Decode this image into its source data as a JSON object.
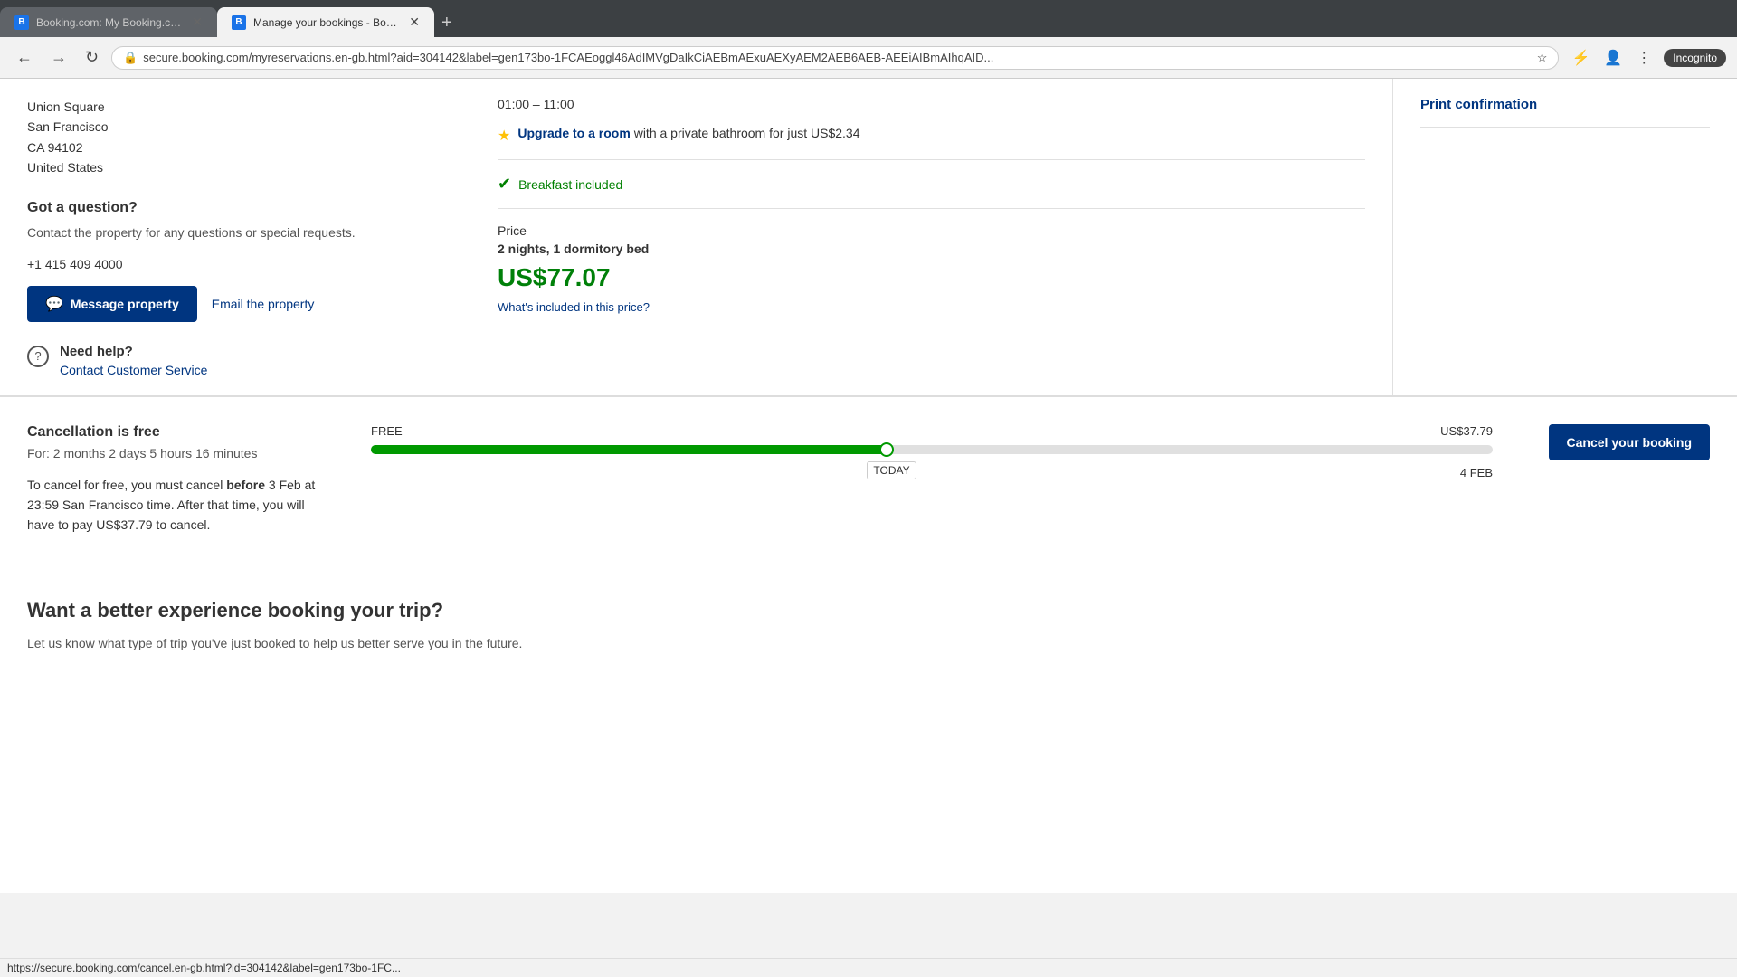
{
  "browser": {
    "tabs": [
      {
        "id": "tab1",
        "favicon": "B",
        "title": "Booking.com: My Booking.com",
        "active": false
      },
      {
        "id": "tab2",
        "favicon": "B",
        "title": "Manage your bookings - Booki...",
        "active": true
      }
    ],
    "new_tab_label": "+",
    "address": "secure.booking.com/myreservations.en-gb.html?aid=304142&label=gen173bo-1FCAEoggl46AdIMVgDaIkCiAEBmAExuAEXyAEM2AEB6AEB-AEEiAIBmAIhqAID...",
    "incognito_label": "Incognito"
  },
  "status_bar": {
    "url": "https://secure.booking.com/cancel.en-gb.html?id=304142&label=gen173bo-1FC..."
  },
  "left": {
    "address_lines": [
      "Union Square",
      "San Francisco",
      "CA 94102",
      "United States"
    ],
    "question_title": "Got a question?",
    "question_desc": "Contact the property for any questions or special requests.",
    "phone": "+1 415 409 4000",
    "message_btn_label": "Message property",
    "email_link_label": "Email the property",
    "help_title": "Need help?",
    "help_link_label": "Contact Customer Service"
  },
  "middle": {
    "time_range": "01:00 – 11:00",
    "upgrade_link_label": "Upgrade to a room",
    "upgrade_text": "with a private bathroom for just US$2.34",
    "breakfast_label": "Breakfast included",
    "price_label": "Price",
    "nights_label": "2 nights, 1 dormitory bed",
    "price_amount": "US$77.07",
    "price_included_link": "What's included in this price?"
  },
  "right": {
    "print_label": "Print confirmation"
  },
  "cancellation": {
    "title": "Cancellation is free",
    "duration": "For: 2 months 2 days 5 hours 16 minutes",
    "description_before": "To cancel for free, you must cancel ",
    "description_bold": "before",
    "description_after": " 3 Feb at 23:59 San Francisco time. After that time, you will have to pay US$37.79 to cancel.",
    "free_label": "FREE",
    "fee_label": "US$37.79",
    "today_label": "TODAY",
    "date_label": "4 FEB",
    "cancel_btn_label": "Cancel your booking",
    "bar_green_pct": 46
  },
  "better": {
    "title": "Want a better experience booking your trip?",
    "desc": "Let us know what type of trip you've just booked to help us better serve you in the future."
  }
}
